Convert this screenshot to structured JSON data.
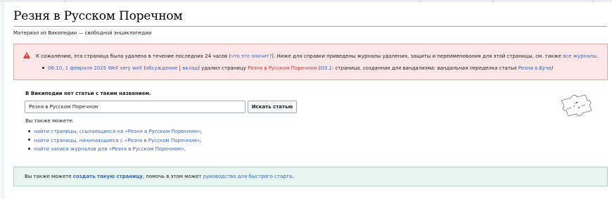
{
  "page": {
    "title": "Резня в Русском Поречном",
    "tagline": "Материал из Википедии — свободной энциклопедии"
  },
  "deleted_notice": {
    "text_before": "К сожалению, эта страница была удалена в течение последних 24 часов (",
    "what_link": "что это значит?",
    "text_middle": "). Ниже для справки приведены журналы удаления, защиты и переименования для этой страницы, см. также ",
    "all_logs_link": "все журналы",
    "text_end": ".",
    "log_entry": {
      "timestamp": "06:10, 1 февраля 2025",
      "user": "Well very well",
      "open_paren": " (",
      "talk_link": "обсуждение",
      "separator": " | ",
      "contrib_link": "вклад",
      "close_paren": ")",
      "action": " удалил страницу ",
      "page_link": "Резня в Русском Поречном",
      "reason_open": " (",
      "reason_code": "О3.1",
      "reason_text": ": страница, созданная для вандализма: вандальная переделка статьи ",
      "reason_link": "Резня в Буче",
      "reason_close": ")"
    }
  },
  "no_article": {
    "heading": "В Википедии нет статьи с таким названием.",
    "search_value": "Резня в Русском Поречном",
    "search_button": "Искать статью",
    "also_label": "Вы также можете:",
    "items": [
      {
        "link": "найти страницы, ссылающиеся на «Резня в Русском Поречном»",
        "end": ";"
      },
      {
        "link": "найти страницы, начинающиеся с «Резня в Русском Поречном»",
        "end": ";"
      },
      {
        "link": "найти записи журналов для «Резня в Русском Поречном»",
        "end": "."
      }
    ]
  },
  "create_notice": {
    "text_before": "Вы также можете ",
    "create_link": "создать такую страницу",
    "text_middle": ", помочь в этом может ",
    "guide_link": "руководство для быстрого старта",
    "text_end": "."
  },
  "colors": {
    "link": "#3366cc",
    "redlink": "#d73333",
    "error_bg": "#fee7e6",
    "success_bg": "#e8f4ef"
  },
  "icons": {
    "warning": "warning-icon",
    "puzzle": "puzzle-globe-icon"
  }
}
